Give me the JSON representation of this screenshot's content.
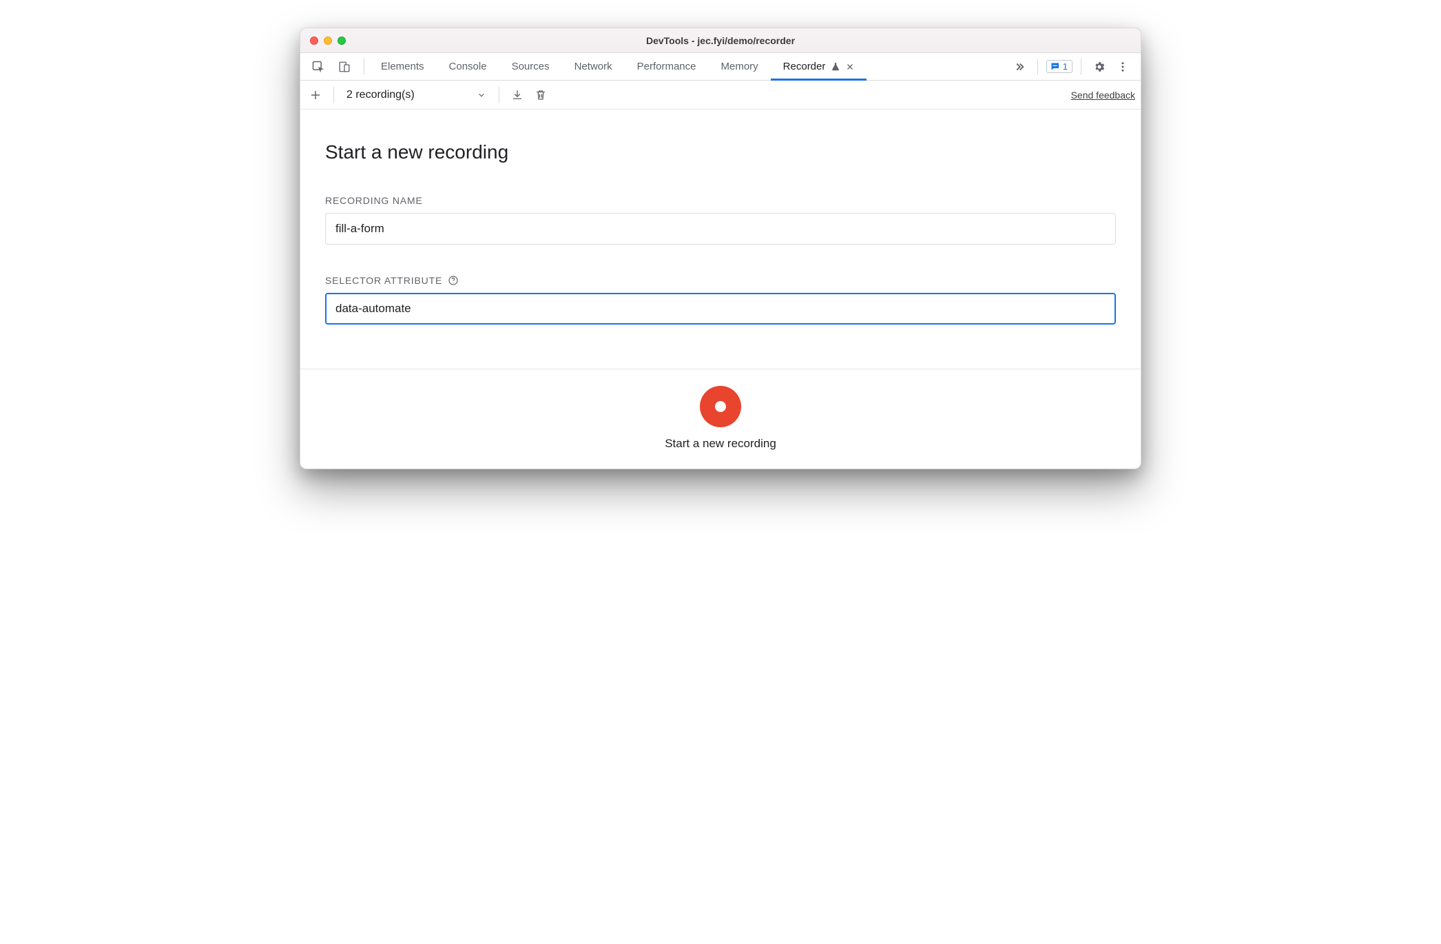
{
  "window": {
    "title": "DevTools - jec.fyi/demo/recorder"
  },
  "tabs": {
    "items": [
      "Elements",
      "Console",
      "Sources",
      "Network",
      "Performance",
      "Memory",
      "Recorder"
    ],
    "active": "Recorder"
  },
  "issues_badge": {
    "count": "1"
  },
  "toolbar": {
    "recordings_label": "2 recording(s)",
    "feedback_label": "Send feedback"
  },
  "page": {
    "heading": "Start a new recording",
    "recording_name": {
      "label": "RECORDING NAME",
      "value": "fill-a-form"
    },
    "selector_attribute": {
      "label": "SELECTOR ATTRIBUTE",
      "value": "data-automate"
    }
  },
  "footer": {
    "start_label": "Start a new recording"
  }
}
